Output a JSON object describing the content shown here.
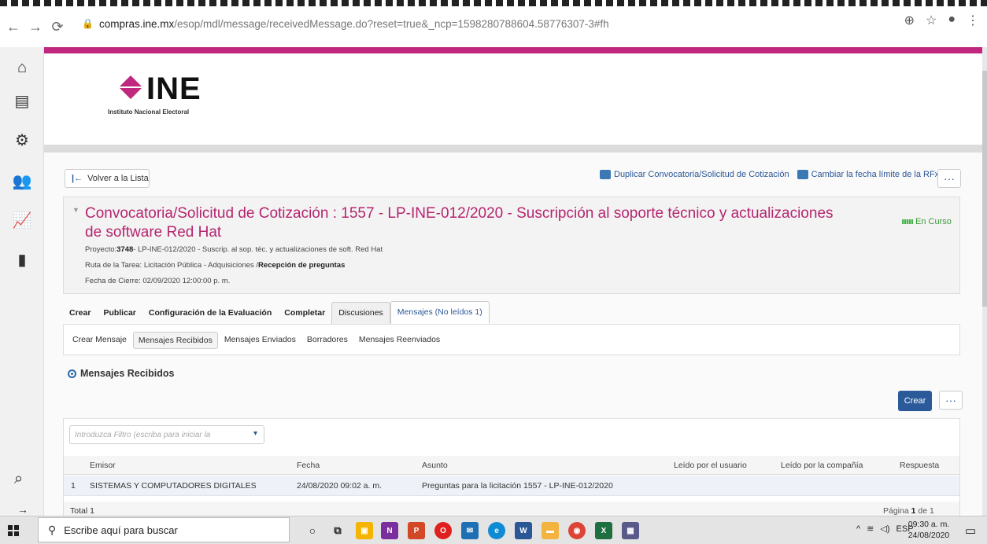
{
  "browser": {
    "url_host": "compras.ine.mx",
    "url_path": "/esop/mdl/message/receivedMessage.do?reset=true&_ncp=1598280788604.58776307-3#fh"
  },
  "logo": {
    "name": "INE",
    "subtitle": "Instituto Nacional Electoral"
  },
  "toolbar": {
    "back_label": "Volver a la Lista",
    "duplicate_label": "Duplicar Convocatoria/Solicitud de Cotización",
    "change_date_label": "Cambiar la fecha límite de la RFx",
    "more_label": "···"
  },
  "header": {
    "title": "Convocatoria/Solicitud de Cotización : 1557 - LP-INE-012/2020 - Suscripción al soporte técnico y actualizaciones de software Red Hat",
    "status": "En Curso",
    "project_prefix": "Proyecto:",
    "project_number": "3748",
    "project_text": "- LP-INE-012/2020 - Suscrip. al sop. téc. y actualizaciones de soft. Red Hat",
    "route_prefix": "Ruta de la Tarea: Licitación Pública - Adquisiciones /",
    "route_current": "Recepción de preguntas",
    "closing_date": "Fecha de Cierre: 02/09/2020 12:00:00 p. m."
  },
  "main_tabs": [
    {
      "label": "Crear"
    },
    {
      "label": "Publicar"
    },
    {
      "label": "Configuración de la Evaluación"
    },
    {
      "label": "Completar"
    },
    {
      "label": "Discusiones"
    },
    {
      "label": "Mensajes (No leídos 1)"
    }
  ],
  "sub_tabs": [
    {
      "label": "Crear Mensaje"
    },
    {
      "label": "Mensajes Recibidos"
    },
    {
      "label": "Mensajes Enviados"
    },
    {
      "label": "Borradores"
    },
    {
      "label": "Mensajes Reenviados"
    }
  ],
  "section": {
    "title": "Mensajes Recibidos",
    "create_label": "Crear"
  },
  "table": {
    "filter_placeholder": "Introduzca Filtro (escriba para iniciar la",
    "columns": [
      "Emisor",
      "Fecha",
      "Asunto",
      "Leído por el usuario",
      "Leído por la compañía",
      "Respuesta"
    ],
    "rows": [
      {
        "index": "1",
        "emisor": "SISTEMAS Y COMPUTADORES DIGITALES",
        "fecha": "24/08/2020 09:02 a. m.",
        "asunto": "Preguntas para la licitación 1557 - LP-INE-012/2020"
      }
    ],
    "total": "Total 1",
    "page_prefix": "Página ",
    "page_current": "1",
    "page_suffix": " de 1"
  },
  "taskbar": {
    "search_placeholder": "Escribe aquí para buscar",
    "language": "ESP",
    "time": "09:30 a. m.",
    "date": "24/08/2020"
  },
  "colors": {
    "brand_magenta": "#c0277e",
    "title_magenta": "#b5256f",
    "link_blue": "#2b5797",
    "primary_button": "#2b5a9a",
    "status_green": "#3a9a3a"
  }
}
